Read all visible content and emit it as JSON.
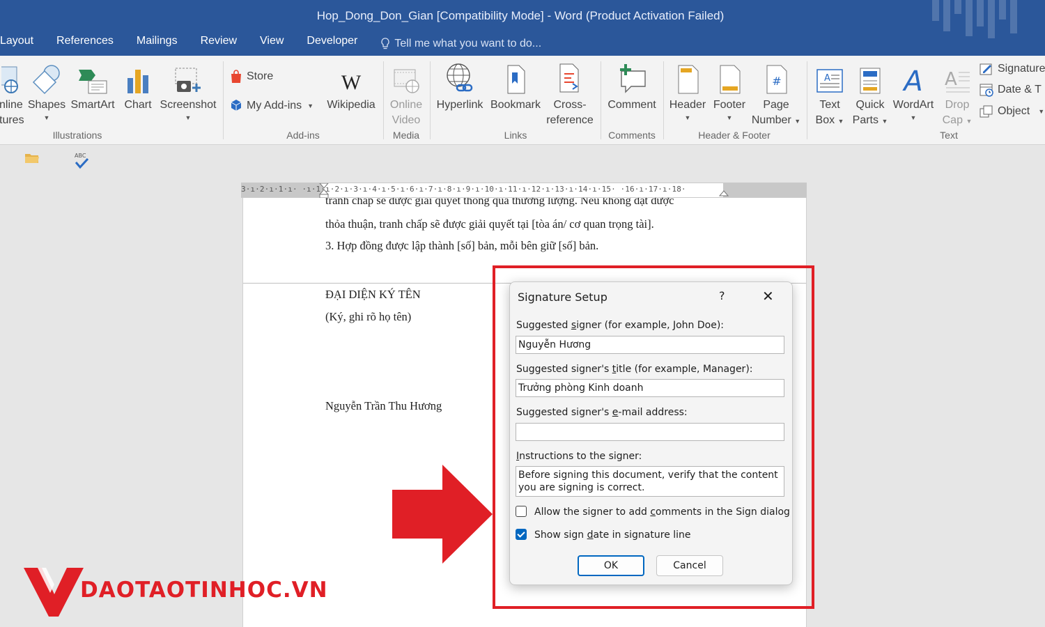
{
  "window": {
    "title": "Hop_Dong_Don_Gian [Compatibility Mode] - Word (Product Activation Failed)"
  },
  "tabs": [
    "Layout",
    "References",
    "Mailings",
    "Review",
    "View",
    "Developer"
  ],
  "tell_me": "Tell me what you want to do...",
  "ribbon": {
    "illustrations": {
      "online_pictures": [
        "nline",
        "tures"
      ],
      "shapes": "Shapes",
      "smartart": "SmartArt",
      "chart": "Chart",
      "screenshot": "Screenshot",
      "group": "Illustrations"
    },
    "addins": {
      "store": "Store",
      "my_addins": "My Add-ins",
      "wikipedia": "Wikipedia",
      "group": "Add-ins"
    },
    "media": {
      "online_video": [
        "Online",
        "Video"
      ],
      "group": "Media"
    },
    "links": {
      "hyperlink": "Hyperlink",
      "bookmark": "Bookmark",
      "cross_reference": [
        "Cross-",
        "reference"
      ],
      "group": "Links"
    },
    "comments": {
      "comment": "Comment",
      "group": "Comments"
    },
    "header_footer": {
      "header": "Header",
      "footer": "Footer",
      "page_number": [
        "Page",
        "Number"
      ],
      "group": "Header & Footer"
    },
    "text": {
      "text_box": [
        "Text",
        "Box"
      ],
      "quick_parts": [
        "Quick",
        "Parts"
      ],
      "wordart": "WordArt",
      "drop_cap": [
        "Drop",
        "Cap"
      ],
      "signature": "Signature",
      "date_time": "Date & T",
      "object": "Object",
      "group": "Text"
    }
  },
  "ruler": {
    "text": "3·ı·2·ı·1·ı·  ·ı·1·ı·2·ı·3·ı·4·ı·5·ı·6·ı·7·ı·8·ı·9·ı·10·ı·11·ı·12·ı·13·ı·14·ı·15·  ·16·ı·17·ı·18·"
  },
  "document": {
    "line_partial": "tranh chấp sẽ được giải quyết thông qua thương lượng. Nếu không đạt được",
    "line1": "thỏa thuận, tranh chấp sẽ được giải quyết tại [tòa án/ cơ quan trọng tài].",
    "line2": "3. Hợp đồng được lập thành [số] bản, mỗi bên giữ [số] bản.",
    "sign_heading": "ĐẠI DIỆN KÝ TÊN",
    "sign_note": "(Ký, ghi rõ họ tên)",
    "signer_name": "Nguyễn Trần Thu Hương"
  },
  "dialog": {
    "title": "Signature Setup",
    "help": "?",
    "close": "✕",
    "signer_label": {
      "pre": "Suggested ",
      "key": "s",
      "post": "igner (for example, John Doe):"
    },
    "signer_value": "Nguyễn Hương",
    "title_label": {
      "pre": "Suggested signer's ",
      "key": "t",
      "post": "itle (for example, Manager):"
    },
    "title_value": "Trưởng phòng Kinh doanh",
    "email_label": {
      "pre": "Suggested signer's ",
      "key": "e",
      "post": "-mail address:"
    },
    "email_value": "",
    "instructions_label": {
      "pre": "",
      "key": "I",
      "post": "nstructions to the signer:"
    },
    "instructions_value": "Before signing this document, verify that the content you are signing is correct.",
    "allow_comments": {
      "pre": "Allow the signer to add ",
      "key": "c",
      "post": "omments in the Sign dialog",
      "checked": false
    },
    "show_date": {
      "pre": "Show sign ",
      "key": "d",
      "post": "ate in signature line",
      "checked": true
    },
    "ok": "OK",
    "cancel": "Cancel"
  },
  "branding": {
    "text": "DAOTAOTINHOC.VN"
  },
  "colors": {
    "title_bar": "#2b579a",
    "highlight": "#e01f26",
    "accent": "#0067c0"
  }
}
